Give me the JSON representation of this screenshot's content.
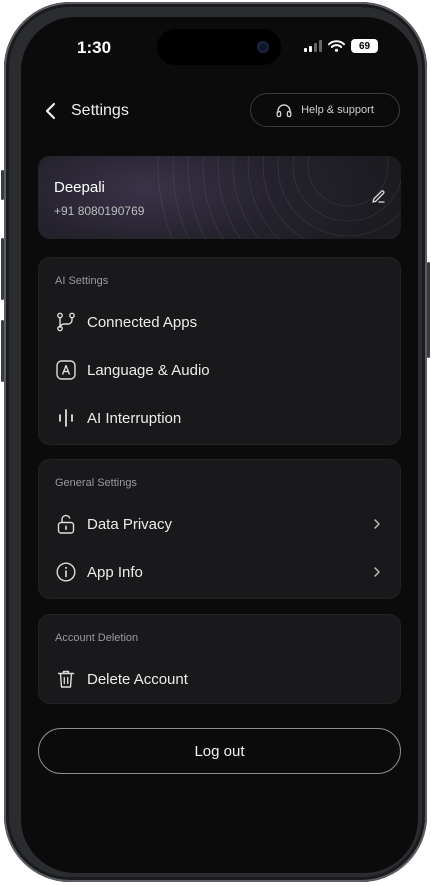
{
  "status_bar": {
    "time": "1:30",
    "battery": "69"
  },
  "header": {
    "title": "Settings",
    "help_label": "Help & support"
  },
  "profile": {
    "name": "Deepali",
    "phone": "+91 8080190769"
  },
  "ai_settings": {
    "label": "AI Settings",
    "items": [
      {
        "label": "Connected Apps",
        "icon": "connected-apps-icon"
      },
      {
        "label": "Language & Audio",
        "icon": "language-icon"
      },
      {
        "label": "AI Interruption",
        "icon": "interruption-icon"
      }
    ]
  },
  "general_settings": {
    "label": "General Settings",
    "items": [
      {
        "label": "Data Privacy",
        "icon": "unlock-icon"
      },
      {
        "label": "App Info",
        "icon": "info-icon"
      }
    ]
  },
  "account_deletion": {
    "label": "Account Deletion",
    "items": [
      {
        "label": "Delete Account",
        "icon": "trash-icon"
      }
    ]
  },
  "logout_label": "Log out"
}
